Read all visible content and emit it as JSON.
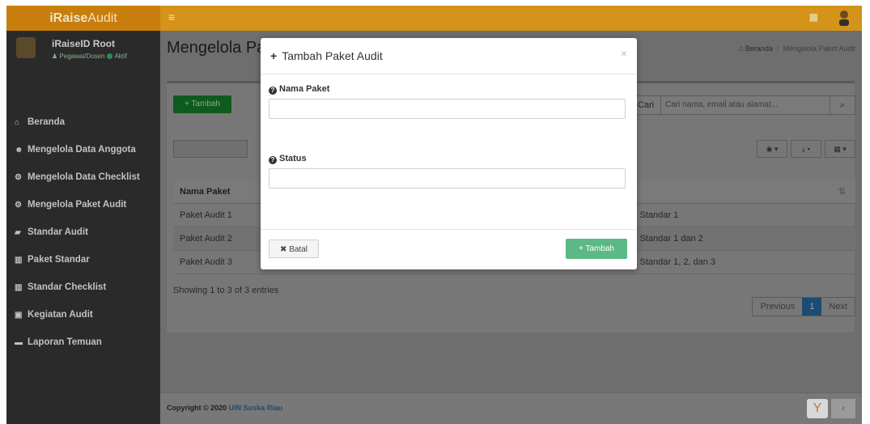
{
  "app": {
    "logo_bold": "iRaise",
    "logo_light": "Audit"
  },
  "navbar": {
    "toggle_icon": "menu-icon",
    "apps_icon": "grid-icon"
  },
  "user": {
    "name": "iRaiseID Root",
    "role": "Pegawai/Dosen",
    "status": "Aktif"
  },
  "sidebar": {
    "items": [
      {
        "label": "Beranda",
        "icon": "home-icon"
      },
      {
        "label": "Mengelola Data Anggota",
        "icon": "users-icon"
      },
      {
        "label": "Mengelola Data Checklist",
        "icon": "cogs-icon"
      },
      {
        "label": "Mengelola Paket Audit",
        "icon": "cogs-icon"
      },
      {
        "label": "Standar Audit",
        "icon": "book-icon"
      },
      {
        "label": "Paket Standar",
        "icon": "bar-chart-icon"
      },
      {
        "label": "Standar Checklist",
        "icon": "bar-chart-icon"
      },
      {
        "label": "Kegiatan Audit",
        "icon": "id-card-icon"
      },
      {
        "label": "Laporan Temuan",
        "icon": "folder-icon"
      }
    ]
  },
  "page": {
    "title": "Mengelola Paket Audit",
    "breadcrumb_home": "Beranda",
    "breadcrumb_current": "Mengelola Paket Audit"
  },
  "toolbar": {
    "add_label": "Tambah",
    "search_label": "Cari",
    "search_placeholder": "Cari nama, email atau alamat..."
  },
  "table": {
    "header": "Nama Paket",
    "rows": [
      {
        "name": "Paket Audit 1",
        "desc": "list Standar 1"
      },
      {
        "name": "Paket Audit 2",
        "desc": "list Standar 1 dan 2"
      },
      {
        "name": "Paket Audit 3",
        "desc": "list Standar 1, 2, dan 3"
      }
    ],
    "showing": "Showing 1 to 3 of 3 entries"
  },
  "pagination": {
    "prev": "Previous",
    "page": "1",
    "next": "Next"
  },
  "footer": {
    "copyright": "Copyright © 2020",
    "org": "UIN Suska Riau"
  },
  "modal": {
    "title": "Tambah Paket Audit",
    "close": "×",
    "field1_label": "Nama Paket",
    "field1_value": "",
    "field2_label": "Status",
    "field2_value": "",
    "cancel_label": "Batal",
    "submit_label": "Tambah",
    "submit_color": "#5cb885"
  }
}
